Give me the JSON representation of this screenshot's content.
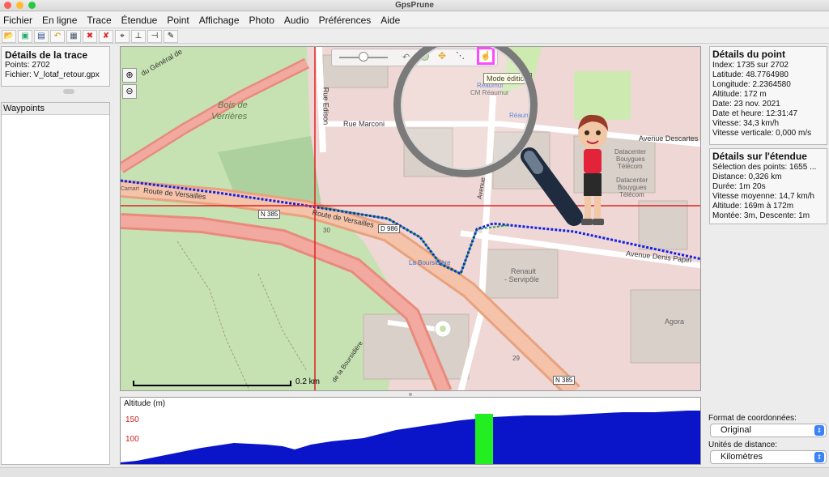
{
  "window": {
    "title": "GpsPrune"
  },
  "menu": [
    "Fichier",
    "En ligne",
    "Trace",
    "Étendue",
    "Point",
    "Affichage",
    "Photo",
    "Audio",
    "Préférences",
    "Aide"
  ],
  "track": {
    "heading": "Détails de la trace",
    "points": "Points: 2702",
    "file": "Fichier: V_lotaf_retour.gpx"
  },
  "waypoints": {
    "heading": "Waypoints"
  },
  "point": {
    "heading": "Détails du point",
    "rows": [
      "Index: 1735 sur 2702",
      "Latitude: 48.7764980",
      "Longitude: 2.2364580",
      "Altitude: 172 m",
      "Date: 23 nov. 2021",
      "Date et heure: 12:31:47",
      "Vitesse: 34,3 km/h",
      "Vitesse verticale: 0,000 m/s"
    ]
  },
  "range": {
    "heading": "Détails sur l'étendue",
    "rows": [
      "Sélection des points: 1655 ...",
      "Distance: 0,326 km",
      "Durée: 1m 20s",
      "Vitesse moyenne: 14,7 km/h",
      "Altitude: 169m à 172m",
      "Montée: 3m, Descente: 1m"
    ]
  },
  "settings": {
    "coord_label": "Format de coordonnées:",
    "coord_value": "Original",
    "units_label": "Unités de distance:",
    "units_value": "Kilomètres"
  },
  "map": {
    "tooltip": "Mode édition",
    "scale": "0.2 km",
    "labels": {
      "bois": "Bois de",
      "verrieres": "Verrières",
      "general": "du Général de",
      "edison": "Rue Edison",
      "marconi": "Rue Marconi",
      "reaumur": "Réaumur",
      "cm_reaumur": "CM Réaumur",
      "reaumur2": "Réaumur",
      "descartes": "Avenue Descartes",
      "datacenter": "Datacenter",
      "bouygues1": "Bouygues",
      "telecom1": "Télécom",
      "datacenter2": "Datacenter",
      "bouygues2": "Bouygues",
      "telecom2": "Télécom",
      "versailles1": "Route de Versailles",
      "versailles2": "Route de Versailles",
      "n385a": "N 385",
      "d986": "D 986",
      "n385b": "N 385",
      "labourside": "La Boursidière",
      "renault": "Renault",
      "servipole": "- Servipôle",
      "denispapin": "Avenue Denis Papin",
      "agora": "Agora",
      "boursidiere": "de la Boursidière",
      "camart": "Camart",
      "n30": "30",
      "n29": "29",
      "avenue": "Avenue"
    }
  },
  "altitude": {
    "label": "Altitude (m)",
    "ticks": [
      "150",
      "100"
    ]
  },
  "colors": {
    "track": "#1020e8",
    "crosshair": "#e02020",
    "selection": "#2aa040",
    "altitude_fill": "#0a14c8",
    "altitude_marker": "#22ee22",
    "tooltip_highlight": "#ff22ff"
  }
}
